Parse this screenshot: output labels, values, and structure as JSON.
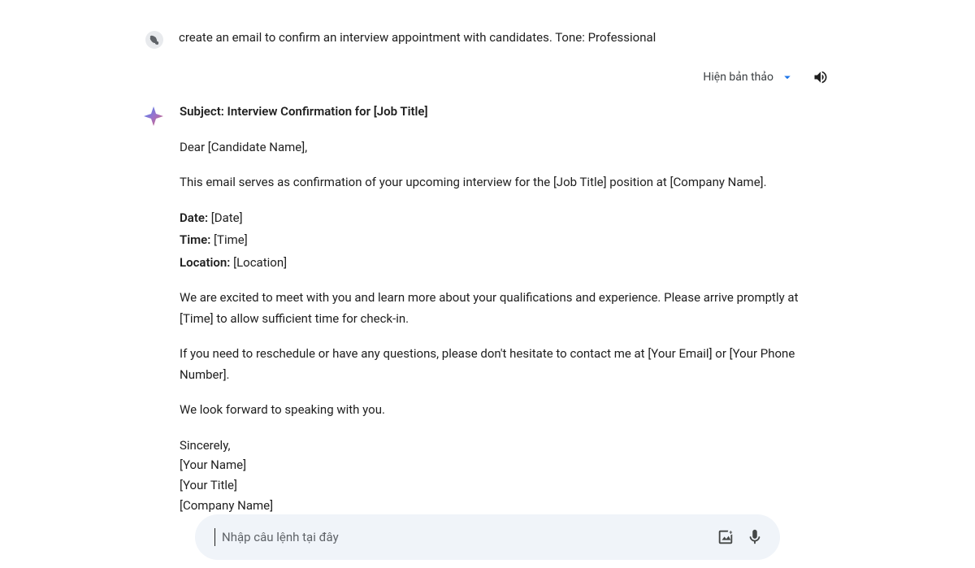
{
  "user": {
    "prompt": "create an email to confirm an interview appointment with candidates. Tone: Professional"
  },
  "controls": {
    "show_draft_label": "Hiện bản thảo"
  },
  "response": {
    "subject_label": "Subject: Interview Confirmation for [Job Title]",
    "greeting": "Dear [Candidate Name],",
    "intro": "This email serves as confirmation of your upcoming interview for the [Job Title] position at [Company Name].",
    "date_label": "Date:",
    "date_value": " [Date]",
    "time_label": "Time:",
    "time_value": " [Time]",
    "location_label": "Location:",
    "location_value": " [Location]",
    "body1": "We are excited to meet with you and learn more about your qualifications and experience. Please arrive promptly at [Time] to allow sufficient time for check-in.",
    "body2": "If you need to reschedule or have any questions, please don't hesitate to contact me at [Your Email] or [Your Phone Number].",
    "closing": "We look forward to speaking with you.",
    "signoff": "Sincerely,",
    "name": "[Your Name]",
    "title": "[Your Title]",
    "company": "[Company Name]"
  },
  "input": {
    "placeholder": "Nhập câu lệnh tại đây"
  }
}
